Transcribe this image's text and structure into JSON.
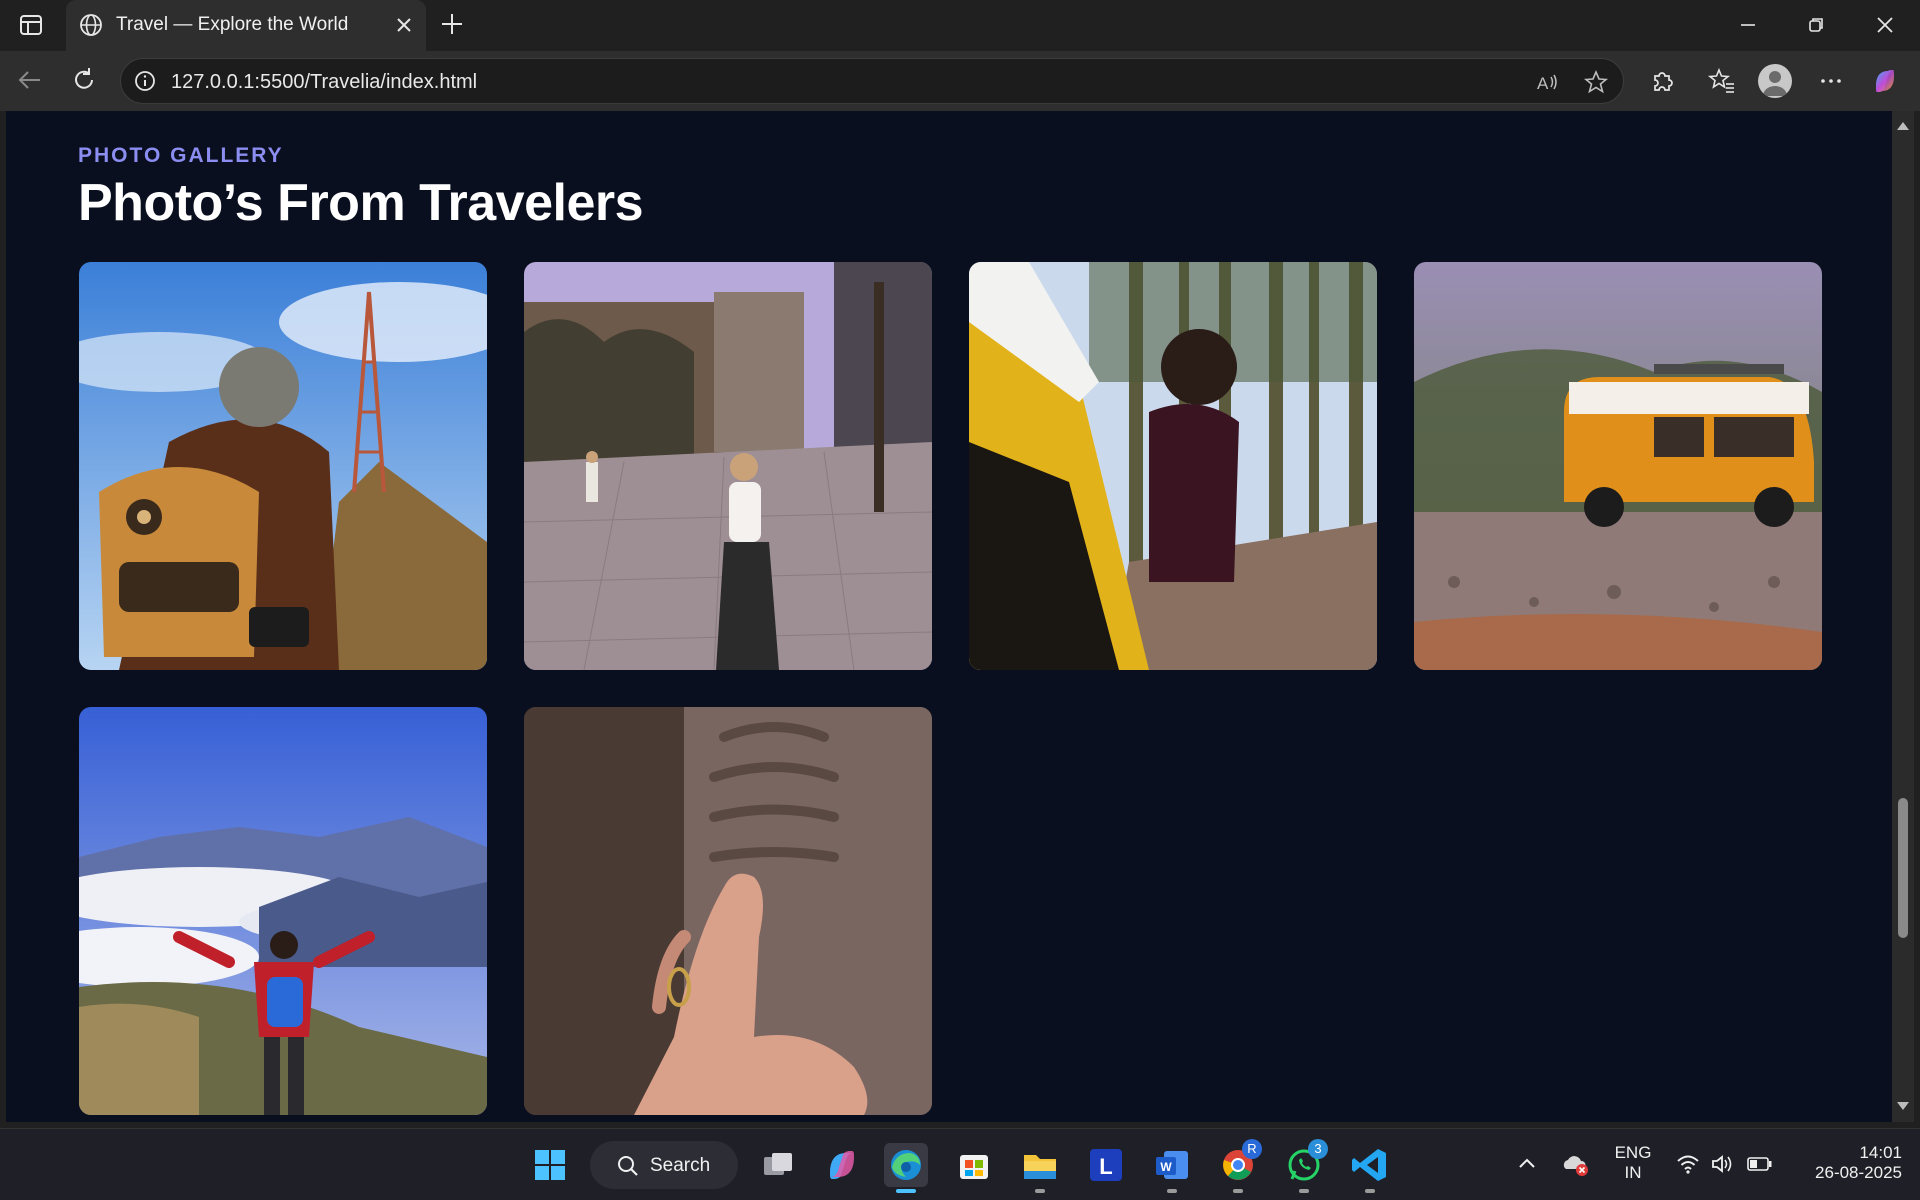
{
  "browser": {
    "tab_title": "Travel — Explore the World",
    "url": "127.0.0.1:5500/Travelia/index.html"
  },
  "page": {
    "eyebrow": "PHOTO GALLERY",
    "heading": "Photo’s From Travelers"
  },
  "gallery": {
    "photos": [
      {
        "subject": "hiker-with-backpack-near-tower"
      },
      {
        "subject": "woman-walking-in-city-square"
      },
      {
        "subject": "woman-leaning-out-of-yellow-van-in-forest"
      },
      {
        "subject": "orange-vw-van-on-gravel"
      },
      {
        "subject": "hiker-arms-open-above-clouds"
      },
      {
        "subject": "hand-touching-carved-stone"
      }
    ]
  },
  "taskbar": {
    "search_label": "Search",
    "language_line1": "ENG",
    "language_line2": "IN",
    "time": "14:01",
    "date": "26-08-2025",
    "chrome_badge": "R",
    "whatsapp_badge": "3"
  },
  "colors": {
    "page_bg": "#0a0f1f",
    "accent": "#8b8df0",
    "heading": "#ffffff"
  }
}
